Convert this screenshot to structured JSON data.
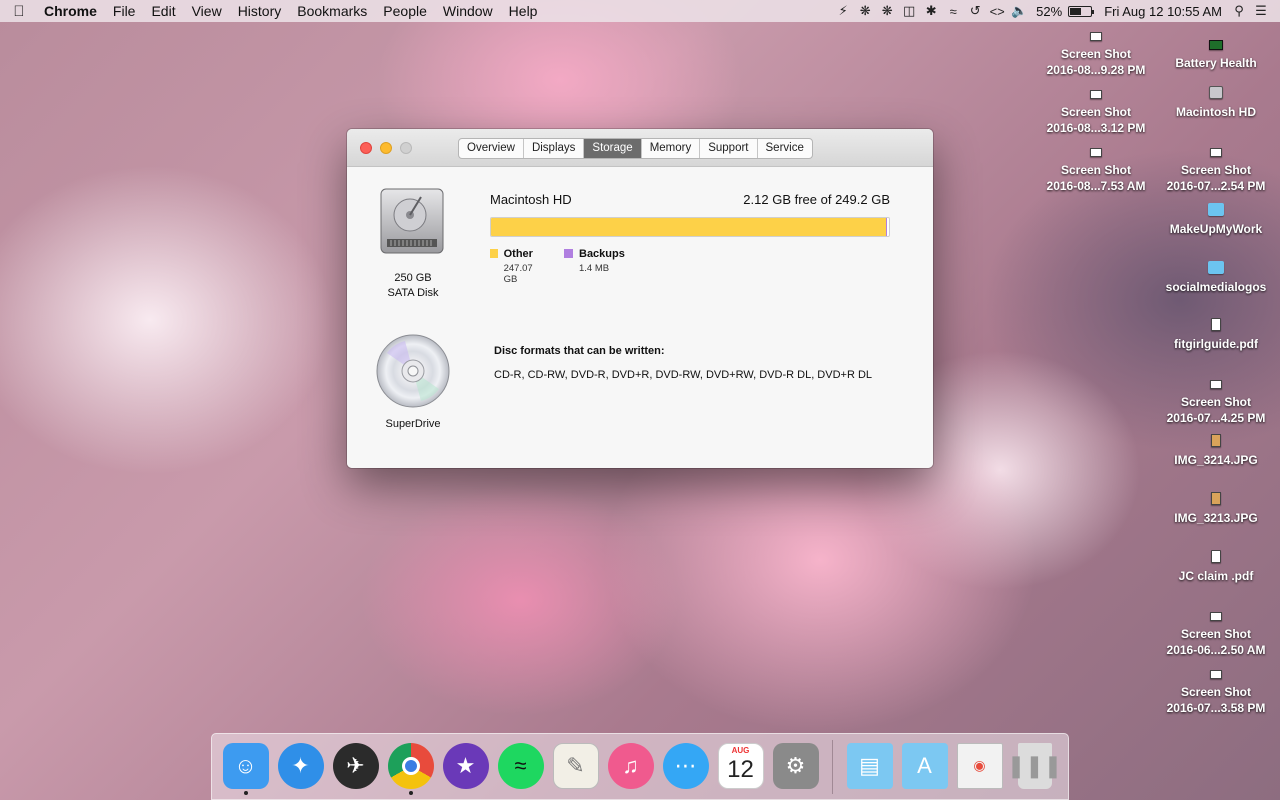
{
  "menubar": {
    "app": "Chrome",
    "items": [
      "File",
      "Edit",
      "View",
      "History",
      "Bookmarks",
      "People",
      "Window",
      "Help"
    ],
    "battery_percent": "52%",
    "battery_level": 0.52,
    "clock": "Fri Aug 12  10:55 AM"
  },
  "desktop": {
    "column_left": [
      {
        "line1": "Screen Shot",
        "line2": "2016-08...9.28 PM",
        "icon": "screenshot-file-icon"
      },
      {
        "line1": "Screen Shot",
        "line2": "2016-08...3.12 PM",
        "icon": "screenshot-file-icon"
      },
      {
        "line1": "Screen Shot",
        "line2": "2016-08...7.53 AM",
        "icon": "screenshot-file-icon"
      }
    ],
    "column_right": [
      {
        "line1": "Battery Health",
        "line2": "",
        "icon": "battery-health-app-icon"
      },
      {
        "line1": "Macintosh HD",
        "line2": "",
        "icon": "hard-drive-icon"
      },
      {
        "line1": "Screen Shot",
        "line2": "2016-07...2.54 PM",
        "icon": "screenshot-file-icon"
      },
      {
        "line1": "MakeUpMyWork",
        "line2": "",
        "icon": "folder-icon"
      },
      {
        "line1": "socialmedialogos",
        "line2": "",
        "icon": "folder-icon"
      },
      {
        "line1": "fitgirlguide.pdf",
        "line2": "",
        "icon": "pdf-file-icon"
      },
      {
        "line1": "Screen Shot",
        "line2": "2016-07...4.25 PM",
        "icon": "screenshot-file-icon"
      },
      {
        "line1": "IMG_3214.JPG",
        "line2": "",
        "icon": "image-file-icon"
      },
      {
        "line1": "IMG_3213.JPG",
        "line2": "",
        "icon": "image-file-icon"
      },
      {
        "line1": "JC claim .pdf",
        "line2": "",
        "icon": "pdf-file-icon"
      },
      {
        "line1": "Screen Shot",
        "line2": "2016-06...2.50 AM",
        "icon": "screenshot-file-icon"
      },
      {
        "line1": "Screen Shot",
        "line2": "2016-07...3.58 PM",
        "icon": "screenshot-file-icon"
      }
    ]
  },
  "window": {
    "tabs": [
      "Overview",
      "Displays",
      "Storage",
      "Memory",
      "Support",
      "Service"
    ],
    "active_tab": "Storage",
    "disk": {
      "capacity": "250 GB",
      "type": "SATA Disk",
      "volume_name": "Macintosh HD",
      "free_text": "2.12 GB free of 249.2 GB"
    },
    "usage": [
      {
        "name": "Other",
        "size": "247.07 GB",
        "color": "#fdd148",
        "fraction": 0.9915
      },
      {
        "name": "Backups",
        "size": "1.4 MB",
        "color": "#b07fe0",
        "fraction": 5.6e-06
      }
    ],
    "optical": {
      "name": "SuperDrive",
      "formats_title": "Disc formats that can be written:",
      "formats": "CD-R, CD-RW, DVD-R, DVD+R, DVD-RW, DVD+RW, DVD-R DL, DVD+R DL"
    }
  },
  "dock": {
    "calendar_month": "AUG",
    "calendar_day": "12",
    "apps": [
      {
        "name": "finder-icon",
        "color": "#3d9bf0",
        "running": true
      },
      {
        "name": "safari-icon",
        "color": "#2f8fe8",
        "running": false
      },
      {
        "name": "dashboard-icon",
        "color": "#2b2b2b",
        "running": false
      },
      {
        "name": "chrome-icon",
        "color": "#e84b3c",
        "running": true
      },
      {
        "name": "imovie-icon",
        "color": "#6a39b8",
        "running": false
      },
      {
        "name": "spotify-icon",
        "color": "#1ed760",
        "running": false
      },
      {
        "name": "textedit-icon",
        "color": "#f2efe6",
        "running": false
      },
      {
        "name": "itunes-icon",
        "color": "#f05a8e",
        "running": false
      },
      {
        "name": "messages-icon",
        "color": "#34a7f5",
        "running": false
      },
      {
        "name": "calendar-icon",
        "color": "#ffffff",
        "running": false
      },
      {
        "name": "system-preferences-icon",
        "color": "#8a8a8a",
        "running": false
      }
    ],
    "stacks": [
      {
        "name": "documents-folder-icon",
        "color": "#7cc8f2"
      },
      {
        "name": "applications-folder-icon",
        "color": "#7cc8f2"
      },
      {
        "name": "chrome-window-minimized-icon",
        "color": "#f2f2f2"
      },
      {
        "name": "trash-icon",
        "color": "#dcdcdc"
      }
    ]
  }
}
